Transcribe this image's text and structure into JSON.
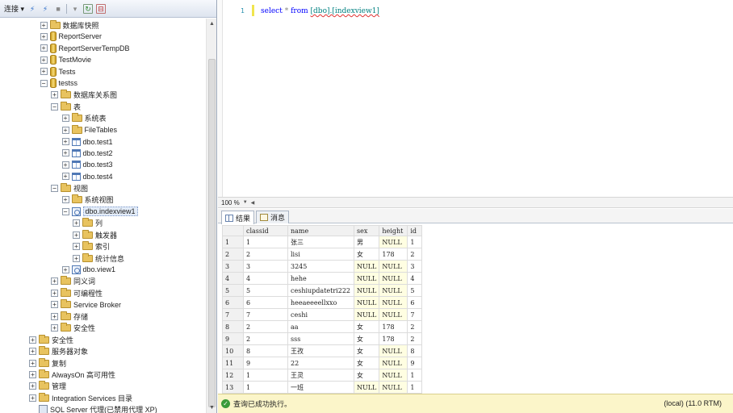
{
  "toolbar": {
    "connect_label": "连接 ▾",
    "icons": [
      "connect-object-explorer-icon",
      "disconnect-icon",
      "stop-icon",
      "filter-icon",
      "refresh-icon",
      "collapse-icon"
    ]
  },
  "tree": [
    {
      "label": "数据库快照",
      "icon": "folder",
      "expander": "+"
    },
    {
      "label": "ReportServer",
      "icon": "db",
      "expander": "+"
    },
    {
      "label": "ReportServerTempDB",
      "icon": "db",
      "expander": "+"
    },
    {
      "label": "TestMovie",
      "icon": "db",
      "expander": "+"
    },
    {
      "label": "Tests",
      "icon": "db",
      "expander": "+"
    },
    {
      "label": "testss",
      "icon": "db",
      "expander": "−"
    },
    {
      "label": "数据库关系图",
      "icon": "folder",
      "expander": "+"
    },
    {
      "label": "表",
      "icon": "folder",
      "expander": "−"
    },
    {
      "label": "系统表",
      "icon": "folder",
      "expander": "+"
    },
    {
      "label": "FileTables",
      "icon": "folder",
      "expander": "+"
    },
    {
      "label": "dbo.test1",
      "icon": "table",
      "expander": "+"
    },
    {
      "label": "dbo.test2",
      "icon": "table",
      "expander": "+"
    },
    {
      "label": "dbo.test3",
      "icon": "table",
      "expander": "+"
    },
    {
      "label": "dbo.test4",
      "icon": "table",
      "expander": "+"
    },
    {
      "label": "视图",
      "icon": "folder",
      "expander": "−"
    },
    {
      "label": "系统视图",
      "icon": "folder",
      "expander": "+"
    },
    {
      "label": "dbo.indexview1",
      "icon": "view",
      "expander": "−"
    },
    {
      "label": "列",
      "icon": "folder",
      "expander": "+"
    },
    {
      "label": "触发器",
      "icon": "folder",
      "expander": "+"
    },
    {
      "label": "索引",
      "icon": "folder",
      "expander": "+"
    },
    {
      "label": "统计信息",
      "icon": "folder",
      "expander": "+"
    },
    {
      "label": "dbo.view1",
      "icon": "view",
      "expander": "+"
    },
    {
      "label": "同义词",
      "icon": "folder",
      "expander": "+"
    },
    {
      "label": "可编程性",
      "icon": "folder",
      "expander": "+"
    },
    {
      "label": "Service Broker",
      "icon": "folder",
      "expander": "+"
    },
    {
      "label": "存储",
      "icon": "folder",
      "expander": "+"
    },
    {
      "label": "安全性",
      "icon": "folder",
      "expander": "+"
    },
    {
      "label": "安全性",
      "icon": "folder",
      "expander": "+"
    },
    {
      "label": "服务器对象",
      "icon": "folder",
      "expander": "+"
    },
    {
      "label": "复制",
      "icon": "folder",
      "expander": "+"
    },
    {
      "label": "AlwaysOn 高可用性",
      "icon": "folder",
      "expander": "+"
    },
    {
      "label": "管理",
      "icon": "folder",
      "expander": "+"
    },
    {
      "label": "Integration Services 目录",
      "icon": "folder",
      "expander": "+"
    },
    {
      "label": "SQL Server 代理(已禁用代理 XP)",
      "icon": "agent",
      "expander": ""
    }
  ],
  "editor": {
    "line_number": "1",
    "kw_select": "select",
    "star": "*",
    "kw_from": "from",
    "object_name": "[dbo].[indexview1]"
  },
  "zoom": {
    "value": "100 %"
  },
  "tabs": {
    "results_label": "结果",
    "messages_label": "消息"
  },
  "grid": {
    "columns": [
      "classid",
      "name",
      "sex",
      "height",
      "id"
    ],
    "rows": [
      [
        "1",
        "1",
        "张三",
        "男",
        "NULL",
        "1"
      ],
      [
        "2",
        "2",
        "lisi",
        "女",
        "178",
        "2"
      ],
      [
        "3",
        "3",
        "3245",
        "NULL",
        "NULL",
        "3"
      ],
      [
        "4",
        "4",
        "hehe",
        "NULL",
        "NULL",
        "4"
      ],
      [
        "5",
        "5",
        "ceshiupdatetri222",
        "NULL",
        "NULL",
        "5"
      ],
      [
        "6",
        "6",
        "heeaeeeellxxo",
        "NULL",
        "NULL",
        "6"
      ],
      [
        "7",
        "7",
        "ceshi",
        "NULL",
        "NULL",
        "7"
      ],
      [
        "8",
        "2",
        "aa",
        "女",
        "178",
        "2"
      ],
      [
        "9",
        "2",
        "sss",
        "女",
        "178",
        "2"
      ],
      [
        "10",
        "8",
        "王孜",
        "女",
        "NULL",
        "8"
      ],
      [
        "11",
        "9",
        "22",
        "女",
        "NULL",
        "9"
      ],
      [
        "12",
        "1",
        "王灵",
        "女",
        "NULL",
        "1"
      ],
      [
        "13",
        "1",
        "一班",
        "NULL",
        "NULL",
        "1"
      ]
    ]
  },
  "status": {
    "message": "查询已成功执行。",
    "server": "(local) (11.0 RTM)"
  },
  "colors": {
    "status_bg": "#fbf5c9",
    "null_cell_bg": "#fffee2",
    "keyword": "#0000ff",
    "object_name": "#008080"
  }
}
